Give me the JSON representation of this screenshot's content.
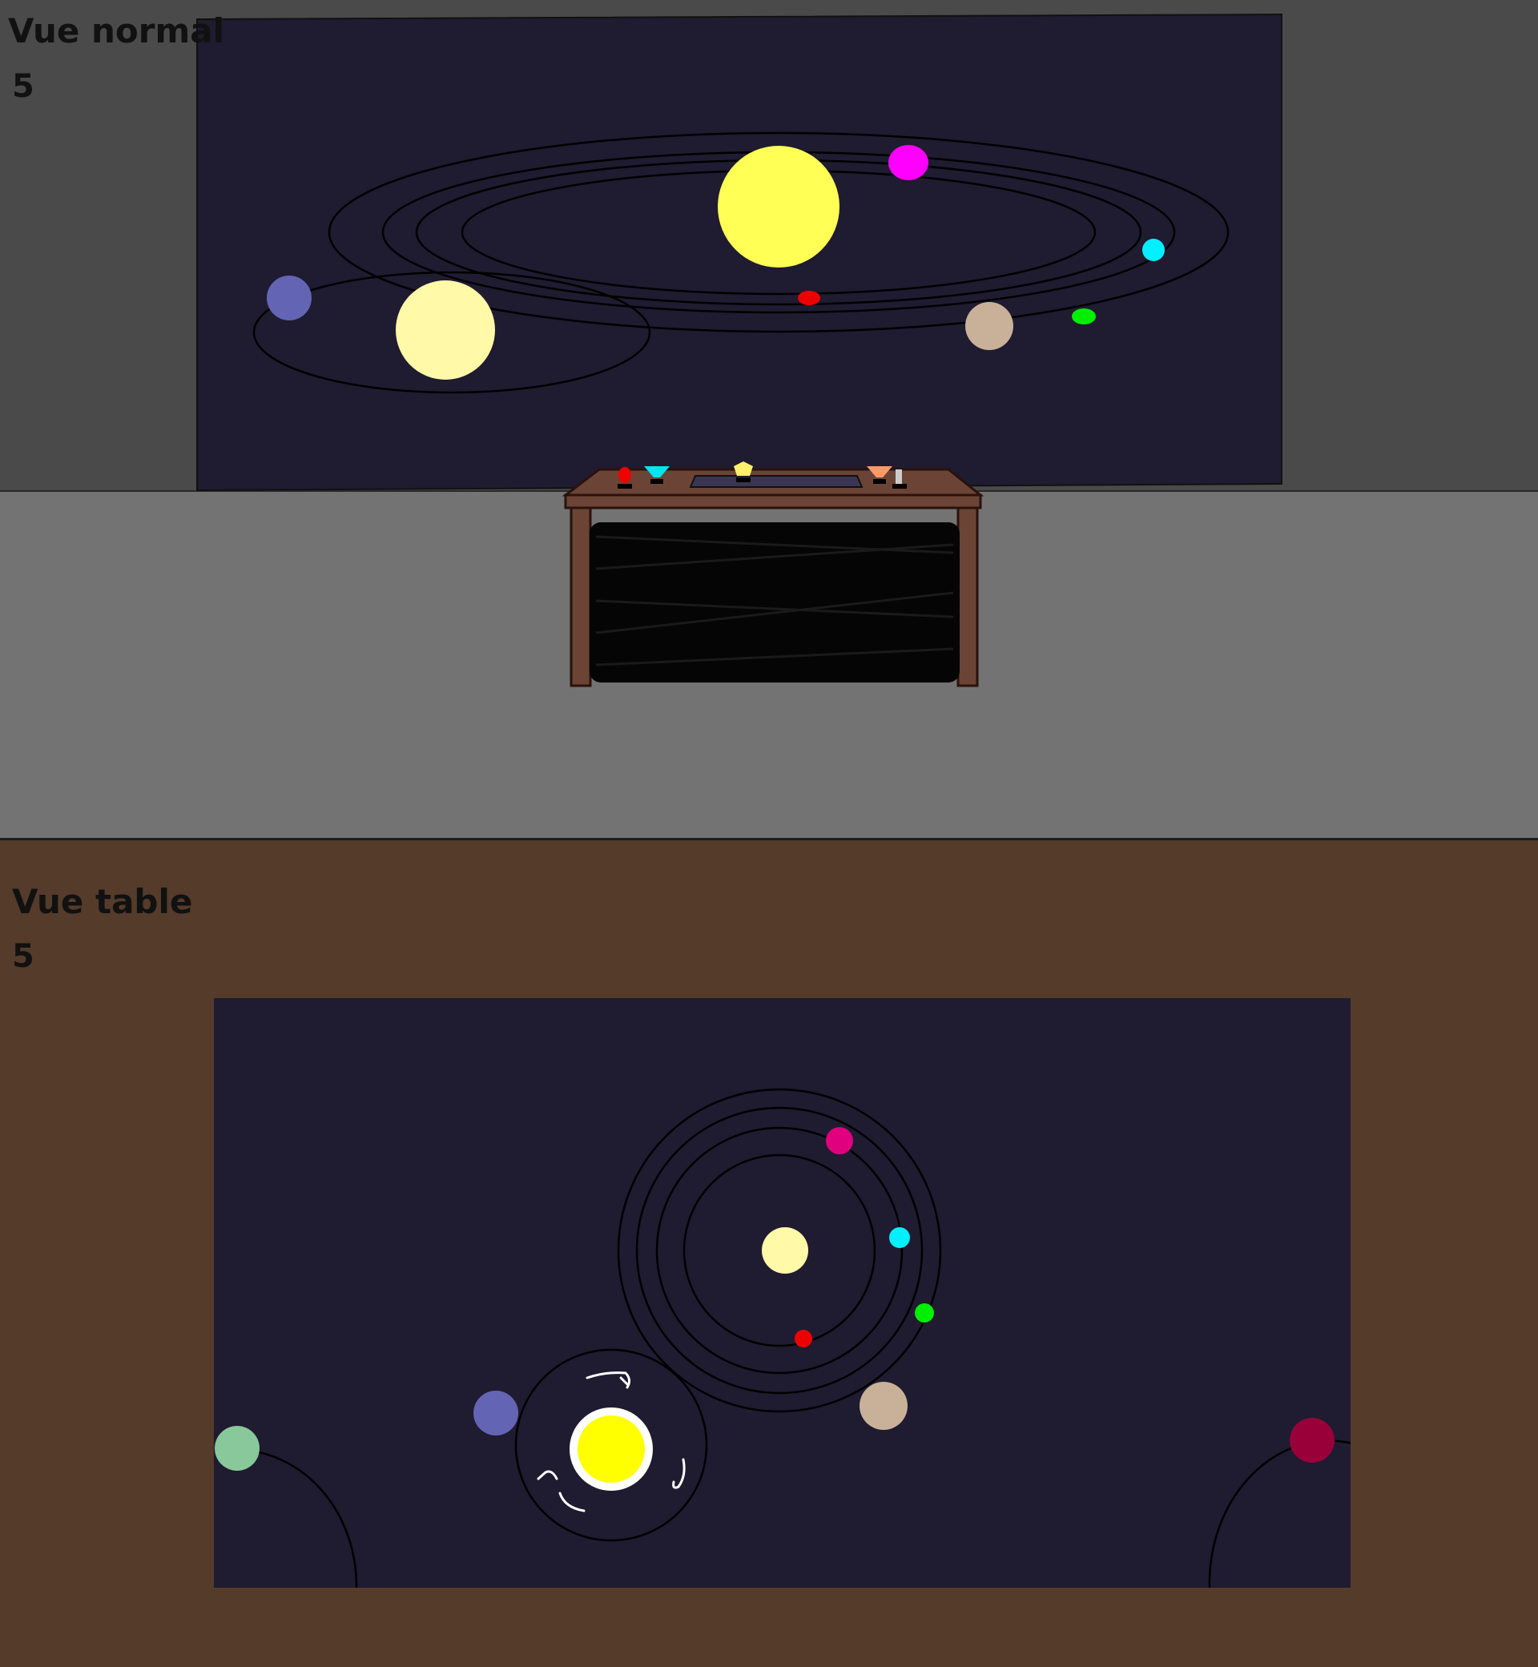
{
  "normal_view": {
    "title": "Vue normal",
    "counter": "5"
  },
  "table_view": {
    "title": "Vue table",
    "counter": "5"
  },
  "colors": {
    "space": "#1f1b30",
    "wall": "#4a4a4a",
    "floor": "#737373",
    "wood_floor": "#543b2a",
    "desk": "#6b4435",
    "sun_yellow": "#ffff55",
    "pale_sun": "#fff9a8",
    "magenta_planet": "#ff00ff",
    "pink_planet": "#e0007f",
    "cyan_planet": "#00f0ff",
    "green_planet": "#00ee00",
    "red_planet": "#ee0000",
    "tan_planet": "#c8b198",
    "violet_planet": "#6464b4",
    "mint_planet": "#88c89a",
    "crimson_planet": "#99003a"
  },
  "desk_controls": [
    "red-knob",
    "cyan-funnel",
    "yellow-gem",
    "orange-funnel",
    "gray-lever"
  ]
}
